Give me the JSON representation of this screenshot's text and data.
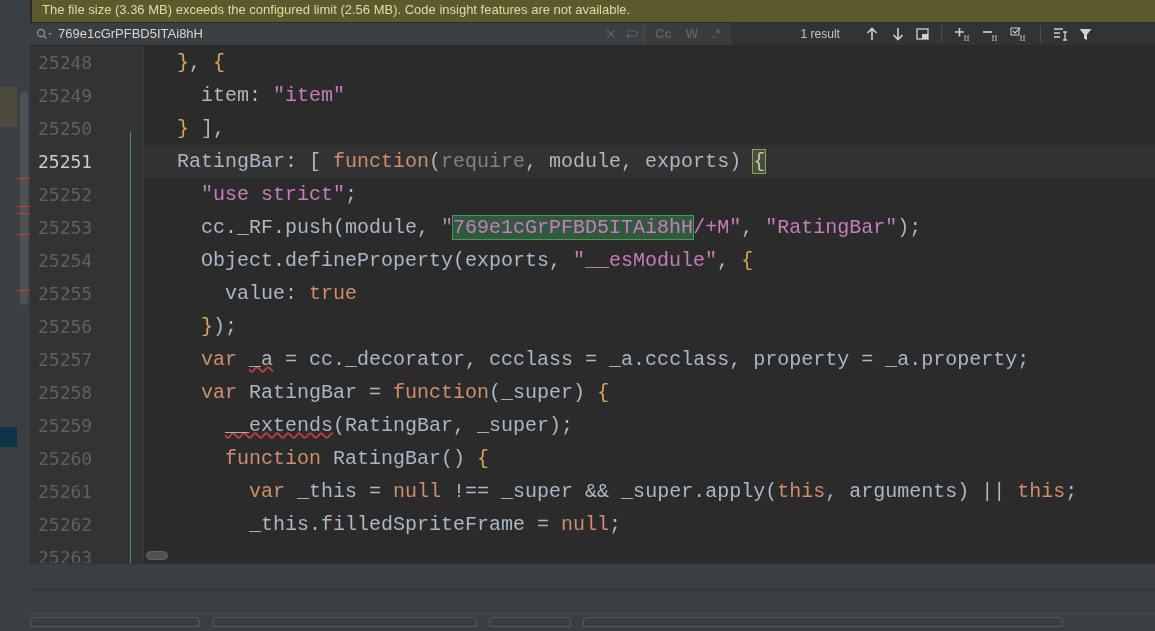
{
  "banner": {
    "text": "The file size (3.36 MB) exceeds the configured limit (2.56 MB). Code insight features are not available."
  },
  "search": {
    "value": "769e1cGrPFBD5ITAi8hH",
    "options": [
      {
        "label": "Cc",
        "selected": false
      },
      {
        "label": "W",
        "selected": false
      },
      {
        "label": ".*",
        "selected": false
      }
    ],
    "result_count": "1 result"
  },
  "editor": {
    "lines": [
      {
        "number": "25248",
        "current": false,
        "tokens": [
          {
            "kind": "bracket",
            "text": "  }"
          },
          {
            "kind": "plain",
            "text": ", "
          },
          {
            "kind": "bracket",
            "text": "{"
          }
        ]
      },
      {
        "number": "25249",
        "current": false,
        "tokens": [
          {
            "kind": "plain",
            "text": "    item: "
          },
          {
            "kind": "string",
            "text": "\"item\""
          }
        ]
      },
      {
        "number": "25250",
        "current": false,
        "tokens": [
          {
            "kind": "bracket",
            "text": "  }"
          },
          {
            "kind": "plain",
            "text": " ],"
          }
        ]
      },
      {
        "number": "25251",
        "current": true,
        "tokens": [
          {
            "kind": "plain",
            "text": "  RatingBar: [ "
          },
          {
            "kind": "keyword",
            "text": "function"
          },
          {
            "kind": "plain",
            "text": "("
          },
          {
            "kind": "param",
            "text": "require"
          },
          {
            "kind": "plain",
            "text": ", module, exports) "
          },
          {
            "kind": "brace_match",
            "text": "{"
          }
        ]
      },
      {
        "number": "25252",
        "current": false,
        "tokens": [
          {
            "kind": "string",
            "text": "    \"use strict\""
          },
          {
            "kind": "plain",
            "text": ";"
          }
        ]
      },
      {
        "number": "25253",
        "current": false,
        "tokens": [
          {
            "kind": "plain",
            "text": "    cc._RF.push(module, "
          },
          {
            "kind": "string",
            "text": "\""
          },
          {
            "kind": "match",
            "text": "769e1cGrPFBD5ITAi8hH"
          },
          {
            "kind": "string",
            "text": "/+M\""
          },
          {
            "kind": "plain",
            "text": ", "
          },
          {
            "kind": "string",
            "text": "\"RatingBar\""
          },
          {
            "kind": "plain",
            "text": ");"
          }
        ]
      },
      {
        "number": "25254",
        "current": false,
        "tokens": [
          {
            "kind": "plain",
            "text": "    Object.defineProperty(exports, "
          },
          {
            "kind": "string",
            "text": "\"__esModule\""
          },
          {
            "kind": "plain",
            "text": ", "
          },
          {
            "kind": "bracket",
            "text": "{"
          }
        ]
      },
      {
        "number": "25255",
        "current": false,
        "tokens": [
          {
            "kind": "plain",
            "text": "      value: "
          },
          {
            "kind": "keyword",
            "text": "true"
          }
        ]
      },
      {
        "number": "25256",
        "current": false,
        "tokens": [
          {
            "kind": "bracket",
            "text": "    }"
          },
          {
            "kind": "plain",
            "text": ");"
          }
        ]
      },
      {
        "number": "25257",
        "current": false,
        "tokens": [
          {
            "kind": "keyword",
            "text": "    var "
          },
          {
            "kind": "warn",
            "text": "_a"
          },
          {
            "kind": "plain",
            "text": " = cc._decorator, ccclass = _a.ccclass, property = _a.property;"
          }
        ]
      },
      {
        "number": "25258",
        "current": false,
        "tokens": [
          {
            "kind": "keyword",
            "text": "    var"
          },
          {
            "kind": "plain",
            "text": " RatingBar = "
          },
          {
            "kind": "keyword",
            "text": "function"
          },
          {
            "kind": "plain",
            "text": "(_super) "
          },
          {
            "kind": "bracket",
            "text": "{"
          }
        ]
      },
      {
        "number": "25259",
        "current": false,
        "tokens": [
          {
            "kind": "warn",
            "text": "      __extends"
          },
          {
            "kind": "plain",
            "text": "(RatingBar, _super);"
          }
        ]
      },
      {
        "number": "25260",
        "current": false,
        "tokens": [
          {
            "kind": "keyword",
            "text": "      function"
          },
          {
            "kind": "plain",
            "text": " RatingBar() "
          },
          {
            "kind": "bracket",
            "text": "{"
          }
        ]
      },
      {
        "number": "25261",
        "current": false,
        "tokens": [
          {
            "kind": "keyword",
            "text": "        var"
          },
          {
            "kind": "plain",
            "text": " _this = "
          },
          {
            "kind": "keyword",
            "text": "null"
          },
          {
            "kind": "plain",
            "text": " !== _super && _super.apply("
          },
          {
            "kind": "keyword",
            "text": "this"
          },
          {
            "kind": "plain",
            "text": ", arguments) || "
          },
          {
            "kind": "keyword",
            "text": "this"
          },
          {
            "kind": "plain",
            "text": ";"
          }
        ]
      },
      {
        "number": "25262",
        "current": false,
        "tokens": [
          {
            "kind": "plain",
            "text": "        _this.filledSpriteFrame = "
          },
          {
            "kind": "keyword",
            "text": "null"
          },
          {
            "kind": "plain",
            "text": ";"
          }
        ]
      },
      {
        "number": "25263",
        "current": false
      }
    ]
  }
}
